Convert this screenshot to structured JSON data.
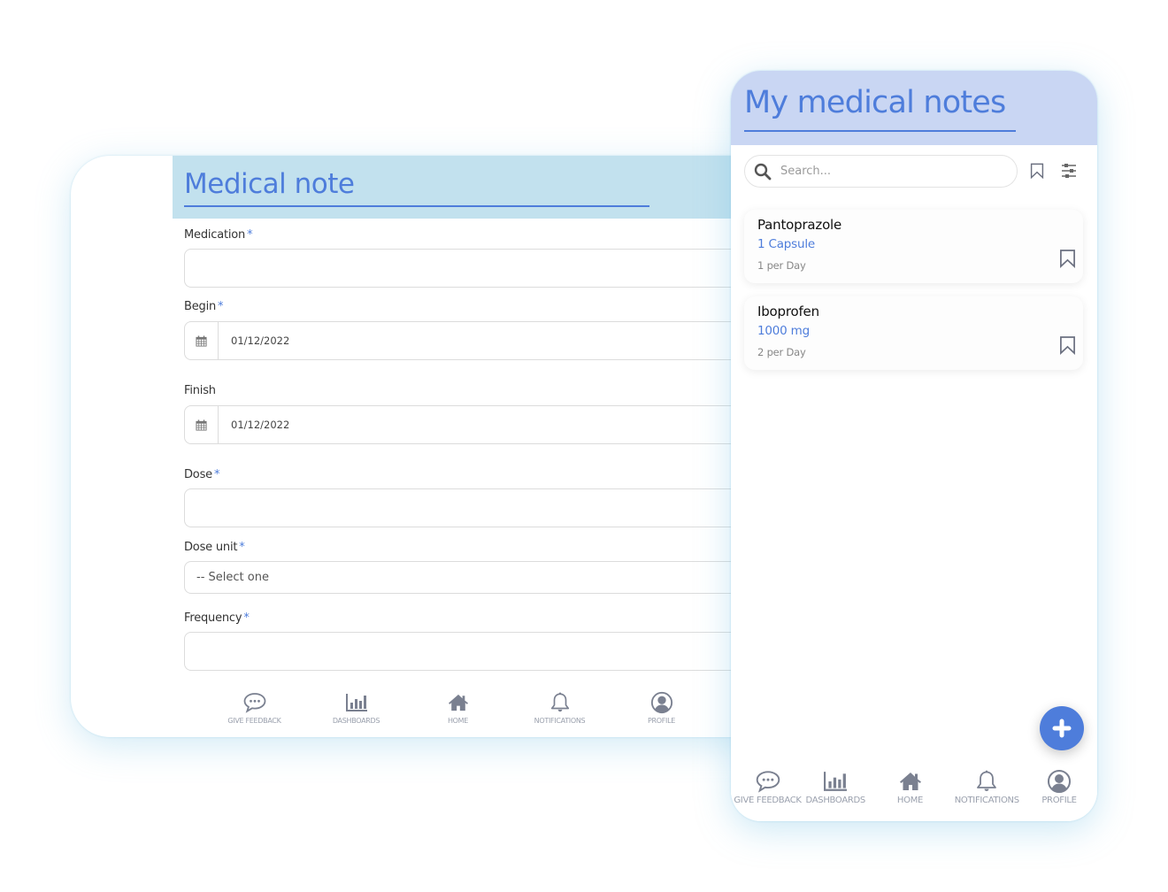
{
  "form": {
    "title": "Medical note",
    "required_marker": "*",
    "fields": {
      "medication": {
        "label": "Medication",
        "value": "",
        "required": true
      },
      "begin": {
        "label": "Begin",
        "value": "01/12/2022",
        "required": true
      },
      "finish": {
        "label": "Finish",
        "value": "01/12/2022",
        "required": false
      },
      "dose": {
        "label": "Dose",
        "value": "",
        "required": true
      },
      "dose_unit": {
        "label": "Dose unit",
        "selected": "-- Select one",
        "required": true
      },
      "frequency": {
        "label": "Frequency",
        "value": "",
        "required": true
      }
    }
  },
  "notes_app": {
    "title": "My medical notes",
    "search": {
      "placeholder": "Search...",
      "value": ""
    },
    "notes": [
      {
        "name": "Pantoprazole",
        "dose": "1 Capsule",
        "frequency": "1 per Day"
      },
      {
        "name": "Iboprofen",
        "dose": "1000 mg",
        "frequency": "2 per Day"
      }
    ],
    "add_button_icon": "plus-icon"
  },
  "nav": {
    "items": [
      {
        "label": "GIVE FEEDBACK",
        "icon": "chat-bubble-icon"
      },
      {
        "label": "DASHBOARDS",
        "icon": "bar-chart-icon"
      },
      {
        "label": "HOME",
        "icon": "home-icon"
      },
      {
        "label": "NOTIFICATIONS",
        "icon": "bell-icon"
      },
      {
        "label": "PROFILE",
        "icon": "user-circle-icon"
      }
    ]
  },
  "colors": {
    "accent": "#4e7ddb",
    "form_header_bg": "#c2e1ee",
    "phone_header_bg": "#c9d6f3",
    "nav_icon": "#7a8090",
    "nav_label": "#9aa0ad"
  }
}
